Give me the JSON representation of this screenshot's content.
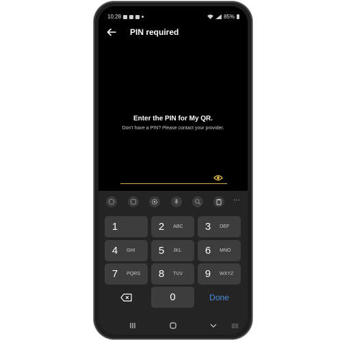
{
  "status_bar": {
    "time": "10:28",
    "battery": "85%"
  },
  "app_bar": {
    "title": "PIN required"
  },
  "prompt": {
    "heading": "Enter the PIN for My QR.",
    "subtext": "Don't have a PIN? Please contact your provider."
  },
  "pin_field": {
    "value": "",
    "show_pin_icon": "eye-icon"
  },
  "keyboard_toolbar": {
    "items": [
      "emoji-icon",
      "sticker-icon",
      "settings-icon",
      "microphone-icon",
      "search-icon",
      "clipboard-icon",
      "more-icon"
    ]
  },
  "keypad": {
    "rows": [
      [
        {
          "num": "1",
          "letters": ""
        },
        {
          "num": "2",
          "letters": "ABC"
        },
        {
          "num": "3",
          "letters": "DEF"
        }
      ],
      [
        {
          "num": "4",
          "letters": "GHI"
        },
        {
          "num": "5",
          "letters": "JKL"
        },
        {
          "num": "6",
          "letters": "MNO"
        }
      ],
      [
        {
          "num": "7",
          "letters": "PQRS"
        },
        {
          "num": "8",
          "letters": "TUV"
        },
        {
          "num": "9",
          "letters": "WXYZ"
        }
      ]
    ],
    "zero": "0",
    "done_label": "Done"
  },
  "nav_bar": {
    "items": [
      "recent-apps-icon",
      "home-icon",
      "back-down-icon",
      "keyboard-icon"
    ]
  },
  "colors": {
    "accent": "#d4b14a",
    "done": "#4a8fe0",
    "key": "#3d3d3d",
    "keyboard_bg": "#242424"
  }
}
